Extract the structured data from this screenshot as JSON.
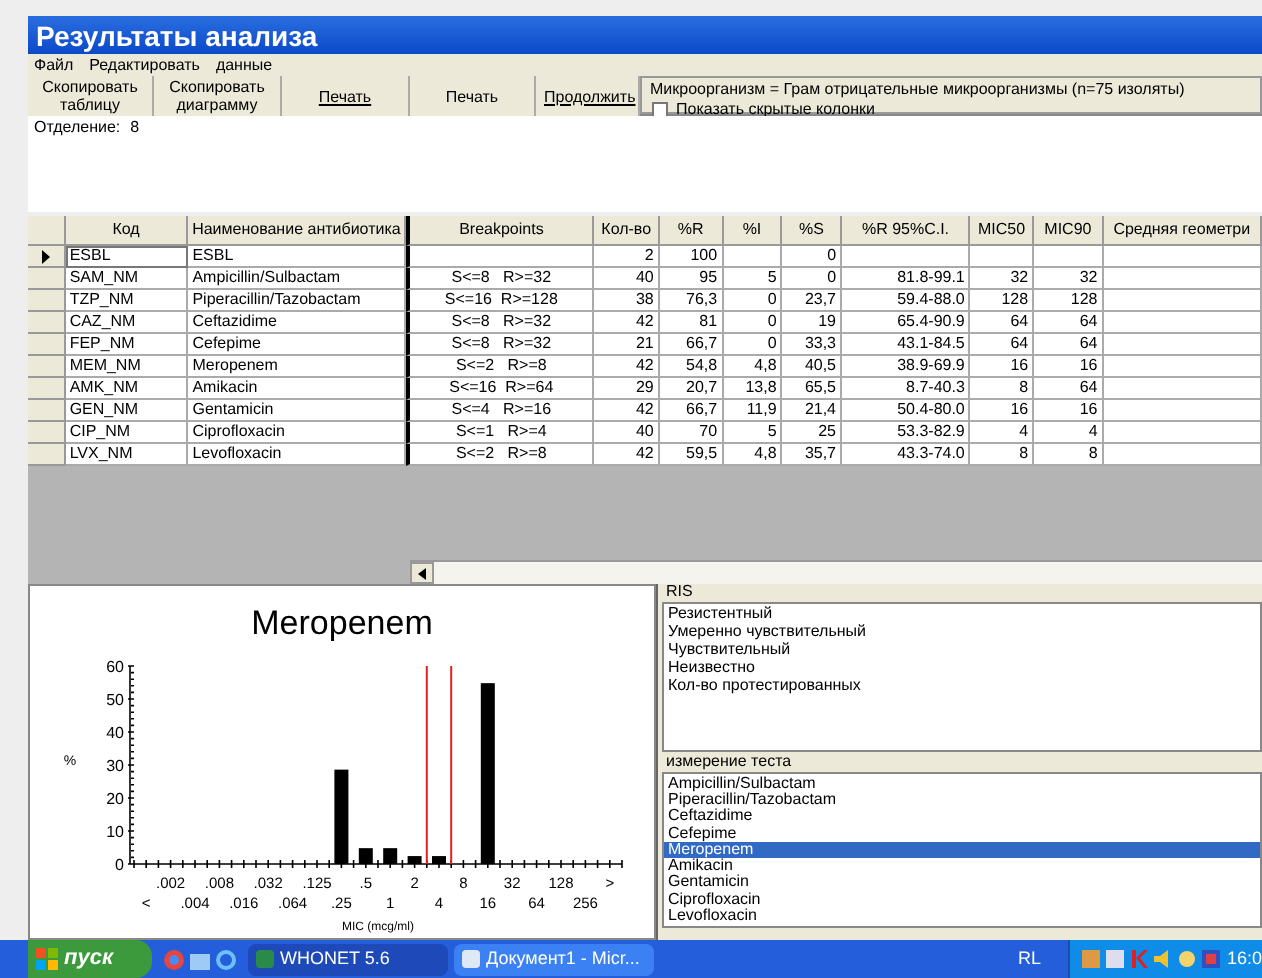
{
  "window": {
    "title": "Результаты анализа"
  },
  "menu": [
    "Файл",
    "Редактировать",
    "данные"
  ],
  "toolbar": [
    {
      "label": "Скопировать таблицу",
      "underlined": false
    },
    {
      "label": "Скопировать диаграмму",
      "underlined": false
    },
    {
      "label": "Печать",
      "underlined": true
    },
    {
      "label": "Печать",
      "underlined": false
    },
    {
      "label": "Продолжить",
      "underlined": true
    }
  ],
  "info": {
    "organism": "Микроорганизм = Грам отрицательные микроорганизмы  (n=75 изоляты)",
    "show_hidden": {
      "label": "Показать скрытые колонки",
      "checked": false
    }
  },
  "department": {
    "label": "Отделение:",
    "value": "8"
  },
  "table": {
    "columns": [
      {
        "label": "Код",
        "kind": "text"
      },
      {
        "label": "Наименование антибиотика",
        "kind": "text"
      },
      {
        "label": "Breakpoints",
        "kind": "range"
      },
      {
        "label": "Кол-во",
        "kind": "number"
      },
      {
        "label": "%R",
        "kind": "number"
      },
      {
        "label": "%I",
        "kind": "number"
      },
      {
        "label": "%S",
        "kind": "number"
      },
      {
        "label": "%R 95%C.I.",
        "kind": "number"
      },
      {
        "label": "MIC50",
        "kind": "number"
      },
      {
        "label": "MIC90",
        "kind": "number"
      },
      {
        "label": "Средняя геометри",
        "kind": "text"
      }
    ],
    "rows": [
      {
        "current": true,
        "cells": [
          "ESBL",
          "ESBL",
          "",
          "2",
          "100",
          "",
          "0",
          "",
          "",
          "",
          ""
        ]
      },
      {
        "current": false,
        "cells": [
          "SAM_NM",
          "Ampicillin/Sulbactam",
          "S<=8   R>=32",
          "40",
          "95",
          "5",
          "0",
          "81.8-99.1",
          "32",
          "32",
          ""
        ]
      },
      {
        "current": false,
        "cells": [
          "TZP_NM",
          "Piperacillin/Tazobactam",
          "S<=16  R>=128",
          "38",
          "76,3",
          "0",
          "23,7",
          "59.4-88.0",
          "128",
          "128",
          ""
        ]
      },
      {
        "current": false,
        "cells": [
          "CAZ_NM",
          "Ceftazidime",
          "S<=8   R>=32",
          "42",
          "81",
          "0",
          "19",
          "65.4-90.9",
          "64",
          "64",
          ""
        ]
      },
      {
        "current": false,
        "cells": [
          "FEP_NM",
          "Cefepime",
          "S<=8   R>=32",
          "21",
          "66,7",
          "0",
          "33,3",
          "43.1-84.5",
          "64",
          "64",
          ""
        ]
      },
      {
        "current": false,
        "cells": [
          "MEM_NM",
          "Meropenem",
          "S<=2   R>=8",
          "42",
          "54,8",
          "4,8",
          "40,5",
          "38.9-69.9",
          "16",
          "16",
          ""
        ]
      },
      {
        "current": false,
        "cells": [
          "AMK_NM",
          "Amikacin",
          "S<=16  R>=64",
          "29",
          "20,7",
          "13,8",
          "65,5",
          "8.7-40.3",
          "8",
          "64",
          ""
        ]
      },
      {
        "current": false,
        "cells": [
          "GEN_NM",
          "Gentamicin",
          "S<=4   R>=16",
          "42",
          "66,7",
          "11,9",
          "21,4",
          "50.4-80.0",
          "16",
          "16",
          ""
        ]
      },
      {
        "current": false,
        "cells": [
          "CIP_NM",
          "Ciprofloxacin",
          "S<=1   R>=4",
          "40",
          "70",
          "5",
          "25",
          "53.3-82.9",
          "4",
          "4",
          ""
        ]
      },
      {
        "current": false,
        "cells": [
          "LVX_NM",
          "Levofloxacin",
          "S<=2   R>=8",
          "42",
          "59,5",
          "4,8",
          "35,7",
          "43.3-74.0",
          "8",
          "8",
          ""
        ]
      }
    ]
  },
  "chart_data": {
    "type": "bar",
    "title": "Meropenem",
    "xlabel": "MIC (mcg/ml)",
    "ylabel": "%",
    "categories": [
      "<",
      ".002",
      ".004",
      ".008",
      ".016",
      ".032",
      ".064",
      ".125",
      ".25",
      ".5",
      "1",
      "2",
      "4",
      "8",
      "16",
      "32",
      "64",
      "128",
      "256",
      ">"
    ],
    "values": [
      null,
      null,
      null,
      null,
      null,
      null,
      null,
      null,
      28.6,
      4.8,
      4.8,
      2.4,
      2.4,
      null,
      54.8,
      null,
      null,
      null,
      null,
      null
    ],
    "ylim": [
      0,
      60
    ],
    "yticks": [
      0,
      10,
      20,
      30,
      40,
      50,
      60
    ]
  },
  "ris": {
    "title": "RIS",
    "items": [
      "Резистентный",
      "Умеренно чувствительный",
      "Чувствительный",
      "Неизвестно",
      "Кол-во протестированных"
    ]
  },
  "tests": {
    "title": "измерение теста",
    "items": [
      {
        "label": "Ampicillin/Sulbactam",
        "selected": false
      },
      {
        "label": "Piperacillin/Tazobactam",
        "selected": false
      },
      {
        "label": "Ceftazidime",
        "selected": false
      },
      {
        "label": "Cefepime",
        "selected": false
      },
      {
        "label": "Meropenem",
        "selected": true
      },
      {
        "label": "Amikacin",
        "selected": false
      },
      {
        "label": "Gentamicin",
        "selected": false
      },
      {
        "label": "Ciprofloxacin",
        "selected": false
      },
      {
        "label": "Levofloxacin",
        "selected": false
      }
    ]
  },
  "taskbar": {
    "start": "пуск",
    "tasks": [
      {
        "label": "WHONET 5.6",
        "selected": true
      },
      {
        "label": "Документ1 - Micr...",
        "selected": false
      }
    ],
    "language": "RL",
    "clock": "16:0"
  }
}
